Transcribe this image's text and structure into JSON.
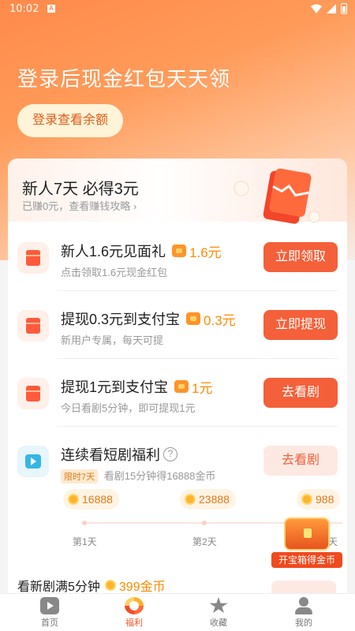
{
  "status_bar": {
    "time": "10:02",
    "notif": "A"
  },
  "hero": {
    "title": "登录后现金红包天天领",
    "login_button": "登录查看余额"
  },
  "newbie": {
    "title": "新人7天 必得3元",
    "subtitle": "已赚0元，查看赚钱攻略",
    "chevron": "›"
  },
  "tasks": [
    {
      "title": "新人1.6元见面礼",
      "reward": "1.6元",
      "subtitle": "点击领取1.6元现金红包",
      "button": "立即领取"
    },
    {
      "title": "提现0.3元到支付宝",
      "reward": "0.3元",
      "subtitle": "新用户专属，每天可提",
      "button": "立即提现"
    },
    {
      "title": "提现1元到支付宝",
      "reward": "1元",
      "subtitle": "今日看剧5分钟，即可提现1元",
      "button": "去看剧"
    }
  ],
  "drama_task": {
    "title": "连续看短剧福利",
    "help": "?",
    "badge": "限时7天",
    "subtitle": "看剧15分钟得16888金币",
    "button": "去看剧"
  },
  "coin_track": {
    "coins": [
      "16888",
      "23888",
      "988"
    ],
    "days": [
      "第1天",
      "第2天",
      "天"
    ]
  },
  "treasure": {
    "label": "开宝箱得金币"
  },
  "watch_new": {
    "title": "看新剧满5分钟",
    "reward": "399金币"
  },
  "tabs": [
    {
      "label": "首页"
    },
    {
      "label": "福利"
    },
    {
      "label": "收藏"
    },
    {
      "label": "我的"
    }
  ],
  "colors": {
    "accent": "#f4603a",
    "reward": "#ff8a00",
    "hero_start": "#ff8a4a"
  }
}
